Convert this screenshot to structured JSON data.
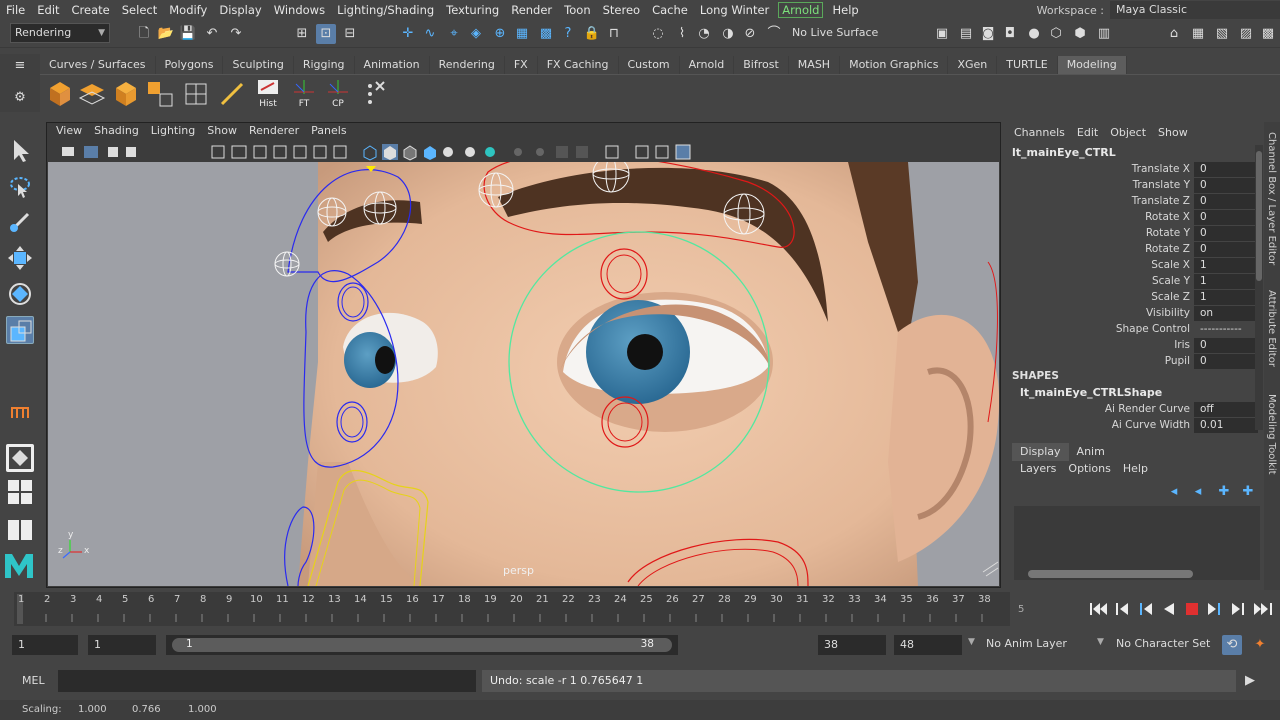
{
  "menubar": {
    "items": [
      "File",
      "Edit",
      "Create",
      "Select",
      "Modify",
      "Display",
      "Windows",
      "Lighting/Shading",
      "Texturing",
      "Render",
      "Toon",
      "Stereo",
      "Cache",
      "Long Winter",
      "Arnold",
      "Help"
    ],
    "workspace_label": "Workspace :",
    "workspace_value": "Maya Classic"
  },
  "statusline": {
    "menuset": "Rendering",
    "live_surface": "No Live Surface"
  },
  "shelf": {
    "tabs": [
      "Curves / Surfaces",
      "Polygons",
      "Sculpting",
      "Rigging",
      "Animation",
      "Rendering",
      "FX",
      "FX Caching",
      "Custom",
      "Arnold",
      "Bifrost",
      "MASH",
      "Motion Graphics",
      "XGen",
      "TURTLE",
      "Modeling"
    ],
    "active_tab": "Modeling",
    "buttons": [
      "Hist",
      "FT",
      "CP"
    ]
  },
  "viewport": {
    "menu": [
      "View",
      "Shading",
      "Lighting",
      "Show",
      "Renderer",
      "Panels"
    ],
    "camera_label": "persp",
    "axis_y": "y",
    "axis_z": "z",
    "axis_x": "x"
  },
  "channel_box": {
    "menu": [
      "Channels",
      "Edit",
      "Object",
      "Show"
    ],
    "object_name": "lt_mainEye_CTRL",
    "attributes": [
      {
        "label": "Translate X",
        "value": "0"
      },
      {
        "label": "Translate Y",
        "value": "0"
      },
      {
        "label": "Translate Z",
        "value": "0"
      },
      {
        "label": "Rotate X",
        "value": "0"
      },
      {
        "label": "Rotate Y",
        "value": "0"
      },
      {
        "label": "Rotate Z",
        "value": "0"
      },
      {
        "label": "Scale X",
        "value": "1"
      },
      {
        "label": "Scale Y",
        "value": "1"
      },
      {
        "label": "Scale Z",
        "value": "1"
      },
      {
        "label": "Visibility",
        "value": "on"
      },
      {
        "label": "Shape Control",
        "value": "-----------"
      },
      {
        "label": "Iris",
        "value": "0"
      },
      {
        "label": "Pupil",
        "value": "0"
      }
    ],
    "shapes_header": "SHAPES",
    "shape_name": "lt_mainEye_CTRLShape",
    "shape_attributes": [
      {
        "label": "Ai Render Curve",
        "value": "off"
      },
      {
        "label": "Ai Curve Width",
        "value": "0.01"
      }
    ]
  },
  "side_tabs": [
    "Channel Box / Layer Editor",
    "Attribute Editor",
    "Modeling Toolkit"
  ],
  "layer_editor": {
    "tabs": [
      "Display",
      "Anim"
    ],
    "active_tab": "Display",
    "menu": [
      "Layers",
      "Options",
      "Help"
    ]
  },
  "timeline": {
    "ticks": [
      "1",
      "2",
      "3",
      "4",
      "5",
      "6",
      "7",
      "8",
      "9",
      "10",
      "11",
      "12",
      "13",
      "14",
      "15",
      "16",
      "17",
      "18",
      "19",
      "20",
      "21",
      "22",
      "23",
      "24",
      "25",
      "26",
      "27",
      "28",
      "29",
      "30",
      "31",
      "32",
      "33",
      "34",
      "35",
      "36",
      "37",
      "38"
    ],
    "current_frame": "5"
  },
  "range": {
    "start": "1",
    "anim_start": "1",
    "range_start": "1",
    "range_end": "38",
    "end": "38",
    "anim_end": "48",
    "anim_layer": "No Anim Layer",
    "character_set": "No Character Set"
  },
  "command": {
    "lang": "MEL",
    "result": "Undo: scale -r 1 0.765647 1"
  },
  "helpline": {
    "label": "Scaling:",
    "x": "1.000",
    "y": "0.766",
    "z": "1.000"
  }
}
